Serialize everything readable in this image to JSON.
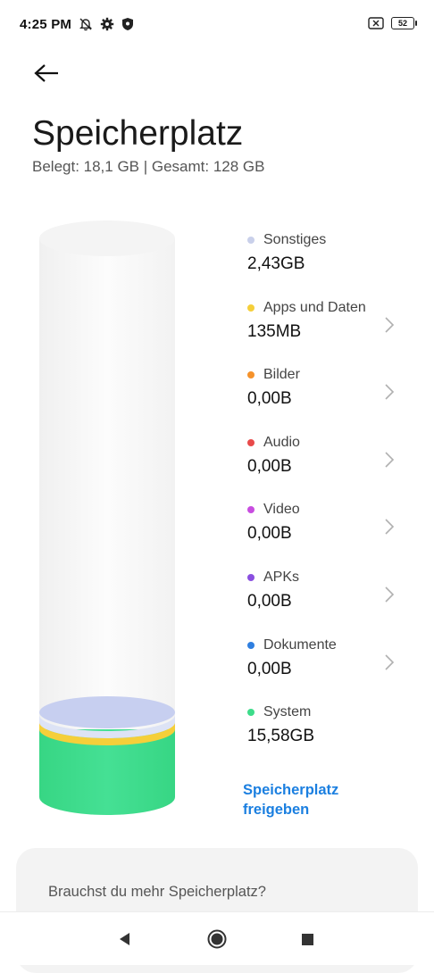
{
  "status_bar": {
    "time": "4:25 PM",
    "battery_level": "52",
    "left_icons": [
      "bell-off-icon",
      "gear-icon",
      "shield-icon"
    ],
    "right_icons": [
      "sim-off-icon",
      "battery-icon"
    ]
  },
  "header": {
    "title": "Speicherplatz",
    "summary": "Belegt: 18,1 GB | Gesamt: 128 GB"
  },
  "storage": {
    "colors": {
      "sonstiges": "#c5cdee",
      "apps": "#f5cf3a",
      "system": "#3ddc8a"
    },
    "items": [
      {
        "name": "Sonstiges",
        "value": "2,43GB",
        "color": "#c9d0ea",
        "chevron": false
      },
      {
        "name": "Apps und Daten",
        "value": "135MB",
        "color": "#f5cf3a",
        "chevron": true
      },
      {
        "name": "Bilder",
        "value": "0,00B",
        "color": "#f5922b",
        "chevron": true
      },
      {
        "name": "Audio",
        "value": "0,00B",
        "color": "#e84a4a",
        "chevron": true
      },
      {
        "name": "Video",
        "value": "0,00B",
        "color": "#c84de0",
        "chevron": true
      },
      {
        "name": "APKs",
        "value": "0,00B",
        "color": "#8a4fe0",
        "chevron": true
      },
      {
        "name": "Dokumente",
        "value": "0,00B",
        "color": "#2f7fe0",
        "chevron": true
      },
      {
        "name": "System",
        "value": "15,58GB",
        "color": "#3ddc8a",
        "chevron": false
      }
    ],
    "free_button": "Speicherplatz freigeben"
  },
  "promo": {
    "text": "Brauchst du mehr Speicherplatz?"
  },
  "nav": {
    "icons": [
      "back-triangle-icon",
      "home-circle-icon",
      "recents-square-icon"
    ]
  }
}
